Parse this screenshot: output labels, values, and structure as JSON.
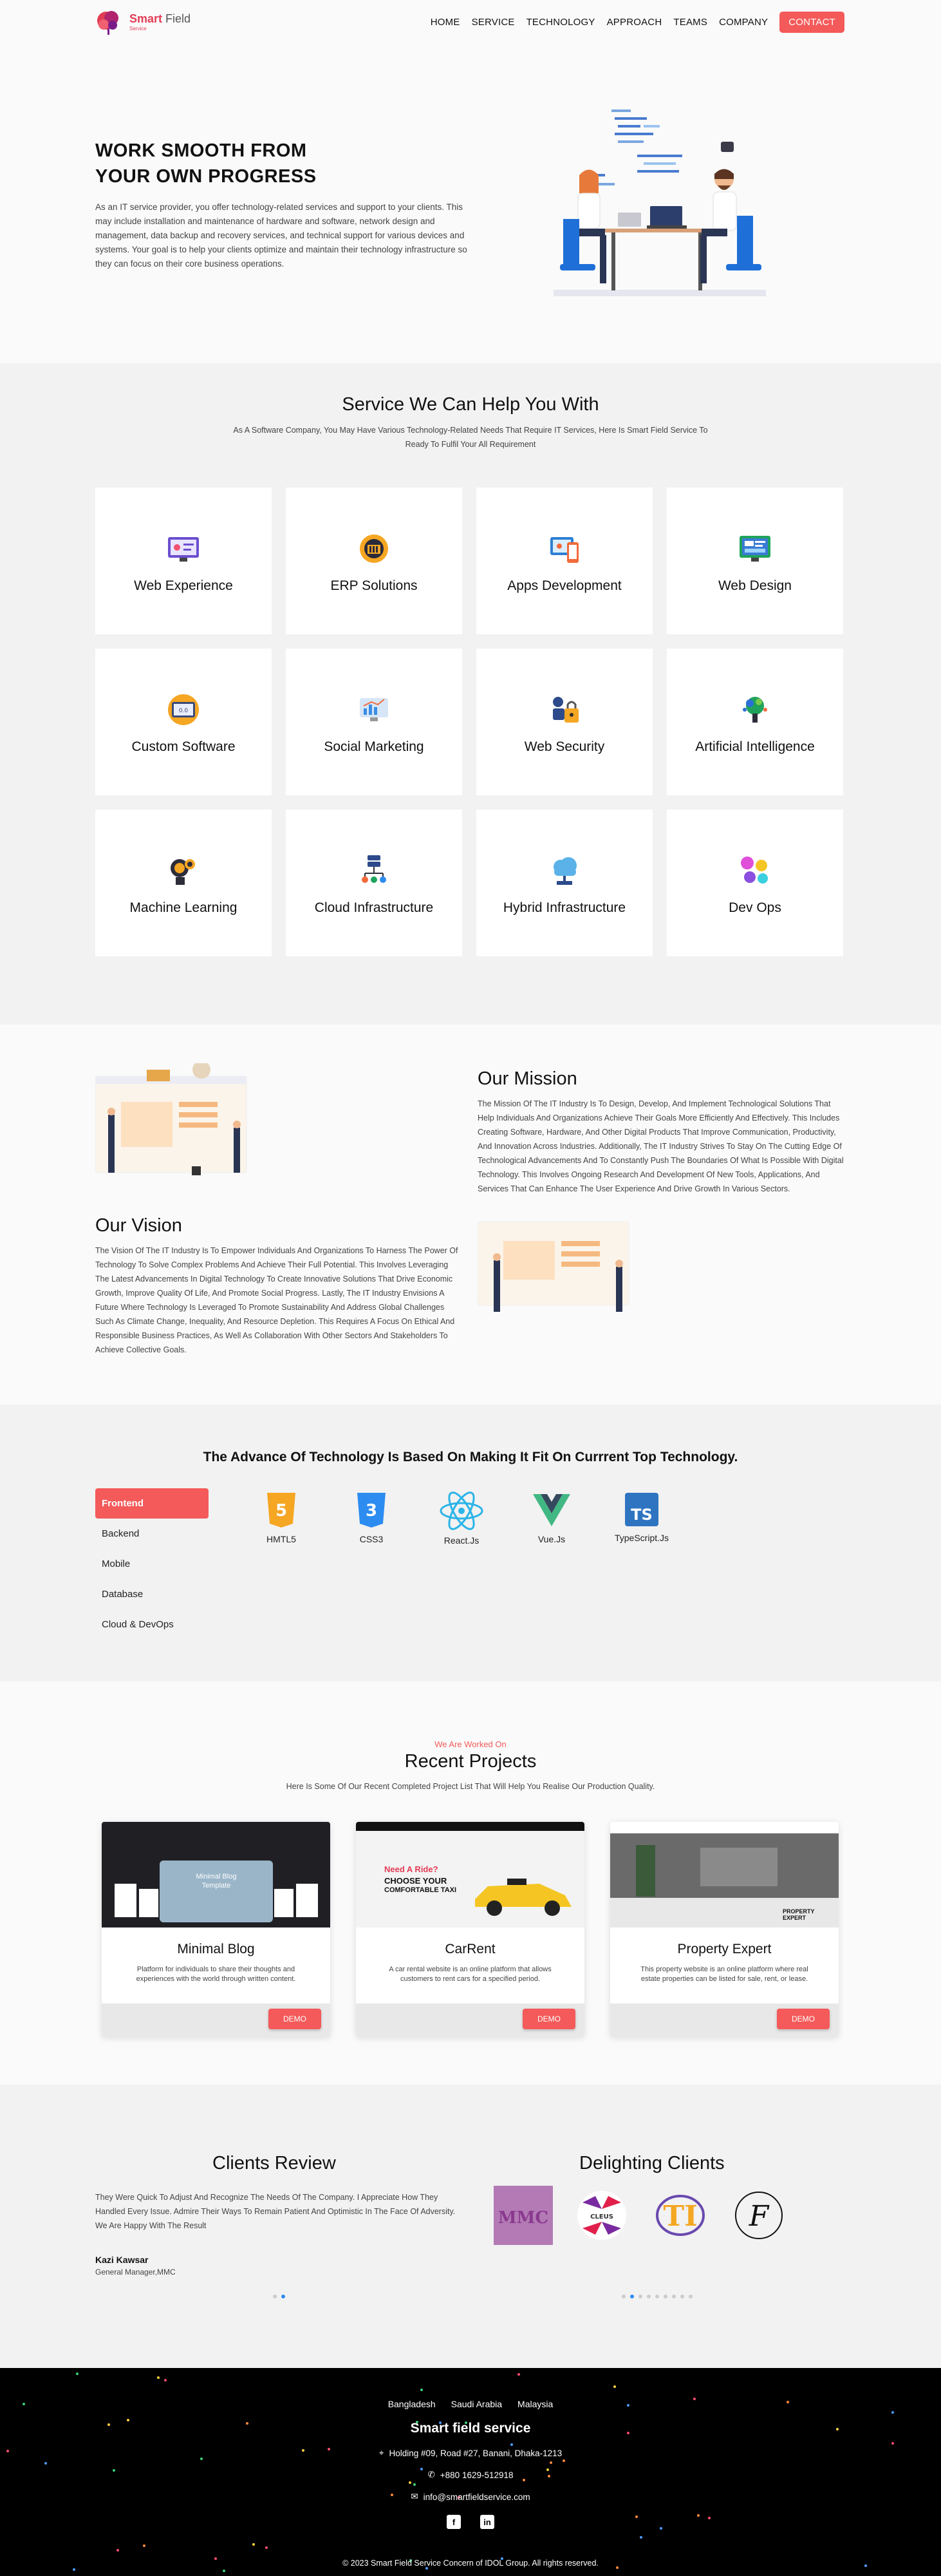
{
  "nav": {
    "logo_word1": "Smart",
    "logo_word2": "Field",
    "logo_tag": "Service",
    "items": [
      "HOME",
      "SERVICE",
      "TECHNOLOGY",
      "APPROACH",
      "TEAMS",
      "COMPANY"
    ],
    "contact": "CONTACT"
  },
  "hero": {
    "title_line1": "WORK SMOOTH FROM",
    "title_line2": "YOUR OWN PROGRESS",
    "text": "As an IT service provider, you offer technology-related services and support to your clients. This may include installation and maintenance of hardware and software, network design and management, data backup and recovery services, and technical support for various devices and systems. Your goal is to help your clients optimize and maintain their technology infrastructure so they can focus on their core business operations."
  },
  "services": {
    "title": "Service We Can Help You With",
    "subtitle": "As A Software Company, You May Have Various Technology-Related Needs That Require IT Services, Here Is Smart Field Service To Ready To Fulfil Your All Requirement",
    "cards": [
      {
        "label": "Web Experience",
        "icon": "web-experience-icon"
      },
      {
        "label": "ERP Solutions",
        "icon": "erp-icon"
      },
      {
        "label": "Apps Development",
        "icon": "apps-icon"
      },
      {
        "label": "Web Design",
        "icon": "web-design-icon"
      },
      {
        "label": "Custom Software",
        "icon": "custom-software-icon"
      },
      {
        "label": "Social Marketing",
        "icon": "social-marketing-icon"
      },
      {
        "label": "Web Security",
        "icon": "web-security-icon"
      },
      {
        "label": "Artificial Intelligence",
        "icon": "ai-icon"
      },
      {
        "label": "Machine Learning",
        "icon": "machine-learning-icon"
      },
      {
        "label": "Cloud Infrastructure",
        "icon": "cloud-infra-icon"
      },
      {
        "label": "Hybrid Infrastructure",
        "icon": "hybrid-infra-icon"
      },
      {
        "label": "Dev Ops",
        "icon": "devops-icon"
      }
    ]
  },
  "mission": {
    "title": "Our Mission",
    "text": "The Mission Of The IT Industry Is To Design, Develop, And Implement Technological Solutions That Help Individuals And Organizations Achieve Their Goals More Efficiently And Effectively. This Includes Creating Software, Hardware, And Other Digital Products That Improve Communication, Productivity, And Innovation Across Industries. Additionally, The IT Industry Strives To Stay On The Cutting Edge Of Technological Advancements And To Constantly Push The Boundaries Of What Is Possible With Digital Technology. This Involves Ongoing Research And Development Of New Tools, Applications, And Services That Can Enhance The User Experience And Drive Growth In Various Sectors."
  },
  "vision": {
    "title": "Our Vision",
    "text": "The Vision Of The IT Industry Is To Empower Individuals And Organizations To Harness The Power Of Technology To Solve Complex Problems And Achieve Their Full Potential. This Involves Leveraging The Latest Advancements In Digital Technology To Create Innovative Solutions That Drive Economic Growth, Improve Quality Of Life, And Promote Social Progress. Lastly, The IT Industry Envisions A Future Where Technology Is Leveraged To Promote Sustainability And Address Global Challenges Such As Climate Change, Inequality, And Resource Depletion. This Requires A Focus On Ethical And Responsible Business Practices, As Well As Collaboration With Other Sectors And Stakeholders To Achieve Collective Goals."
  },
  "technology": {
    "title": "The Advance Of Technology Is Based On Making It Fit On Currrent Top Technology.",
    "tabs": [
      "Frontend",
      "Backend",
      "Mobile",
      "Database",
      "Cloud & DevOps"
    ],
    "items": [
      {
        "label": "HMTL5",
        "icon": "html5-icon",
        "color": "#e44d26"
      },
      {
        "label": "CSS3",
        "icon": "css3-icon",
        "color": "#1572b6"
      },
      {
        "label": "React.Js",
        "icon": "react-icon",
        "color": "#61dafb"
      },
      {
        "label": "Vue.Js",
        "icon": "vue-icon",
        "color": "#41b883"
      },
      {
        "label": "TypeScript.Js",
        "icon": "typescript-icon",
        "color": "#2f74c0"
      }
    ]
  },
  "projects": {
    "kicker": "We Are Worked On",
    "title": "Recent Projects",
    "subtitle": "Here Is Some Of Our Recent Completed Project List That Will Help You Realise Our Production Quality.",
    "items": [
      {
        "title": "Minimal Blog",
        "desc": "Platform for individuals to share their thoughts and experiences with the world through written content.",
        "button": "DEMO"
      },
      {
        "title": "CarRent",
        "desc": "A car rental website is an online platform that allows customers to rent cars for a specified period.",
        "button": "DEMO"
      },
      {
        "title": "Property Expert",
        "desc": "This property website is an online platform where real estate properties can be listed for sale, rent, or lease.",
        "button": "DEMO"
      }
    ],
    "screens": {
      "minimal_badge": "Minimal Blog Template",
      "car_line1": "Need A Ride?",
      "car_line2": "CHOOSE YOUR",
      "car_line3": "COMFORTABLE TAXI",
      "prop_line": "PROPERTY EXPERT"
    }
  },
  "reviews": {
    "title": "Clients Review",
    "text": "They Were Quick To Adjust And Recognize The Needs Of The Company. I Appreciate How They Handled Every Issue. Admire Their Ways To Remain Patient And Optimistic In The Face Of Adversity. We Are Happy With The Result",
    "name": "Kazi Kawsar",
    "role": "General Manager,MMC"
  },
  "clients": {
    "title": "Delighting Clients",
    "logos": [
      "MMC",
      "CLEUS",
      "TI",
      "F"
    ]
  },
  "footer": {
    "countries": [
      "Bangladesh",
      "Saudi Arabia",
      "Malaysia"
    ],
    "title": "Smart field service",
    "address": "Holding #09, Road #27, Banani, Dhaka-1213",
    "phone": "+880 1629-512918",
    "email": "info@smartfieldservice.com",
    "copyright": "© 2023 Smart Field Service Concern of IDOL Group. All rights reserved."
  },
  "colors": {
    "accent": "#f45a5a",
    "brand": "#e23c55",
    "footer_bg": "#000000"
  }
}
